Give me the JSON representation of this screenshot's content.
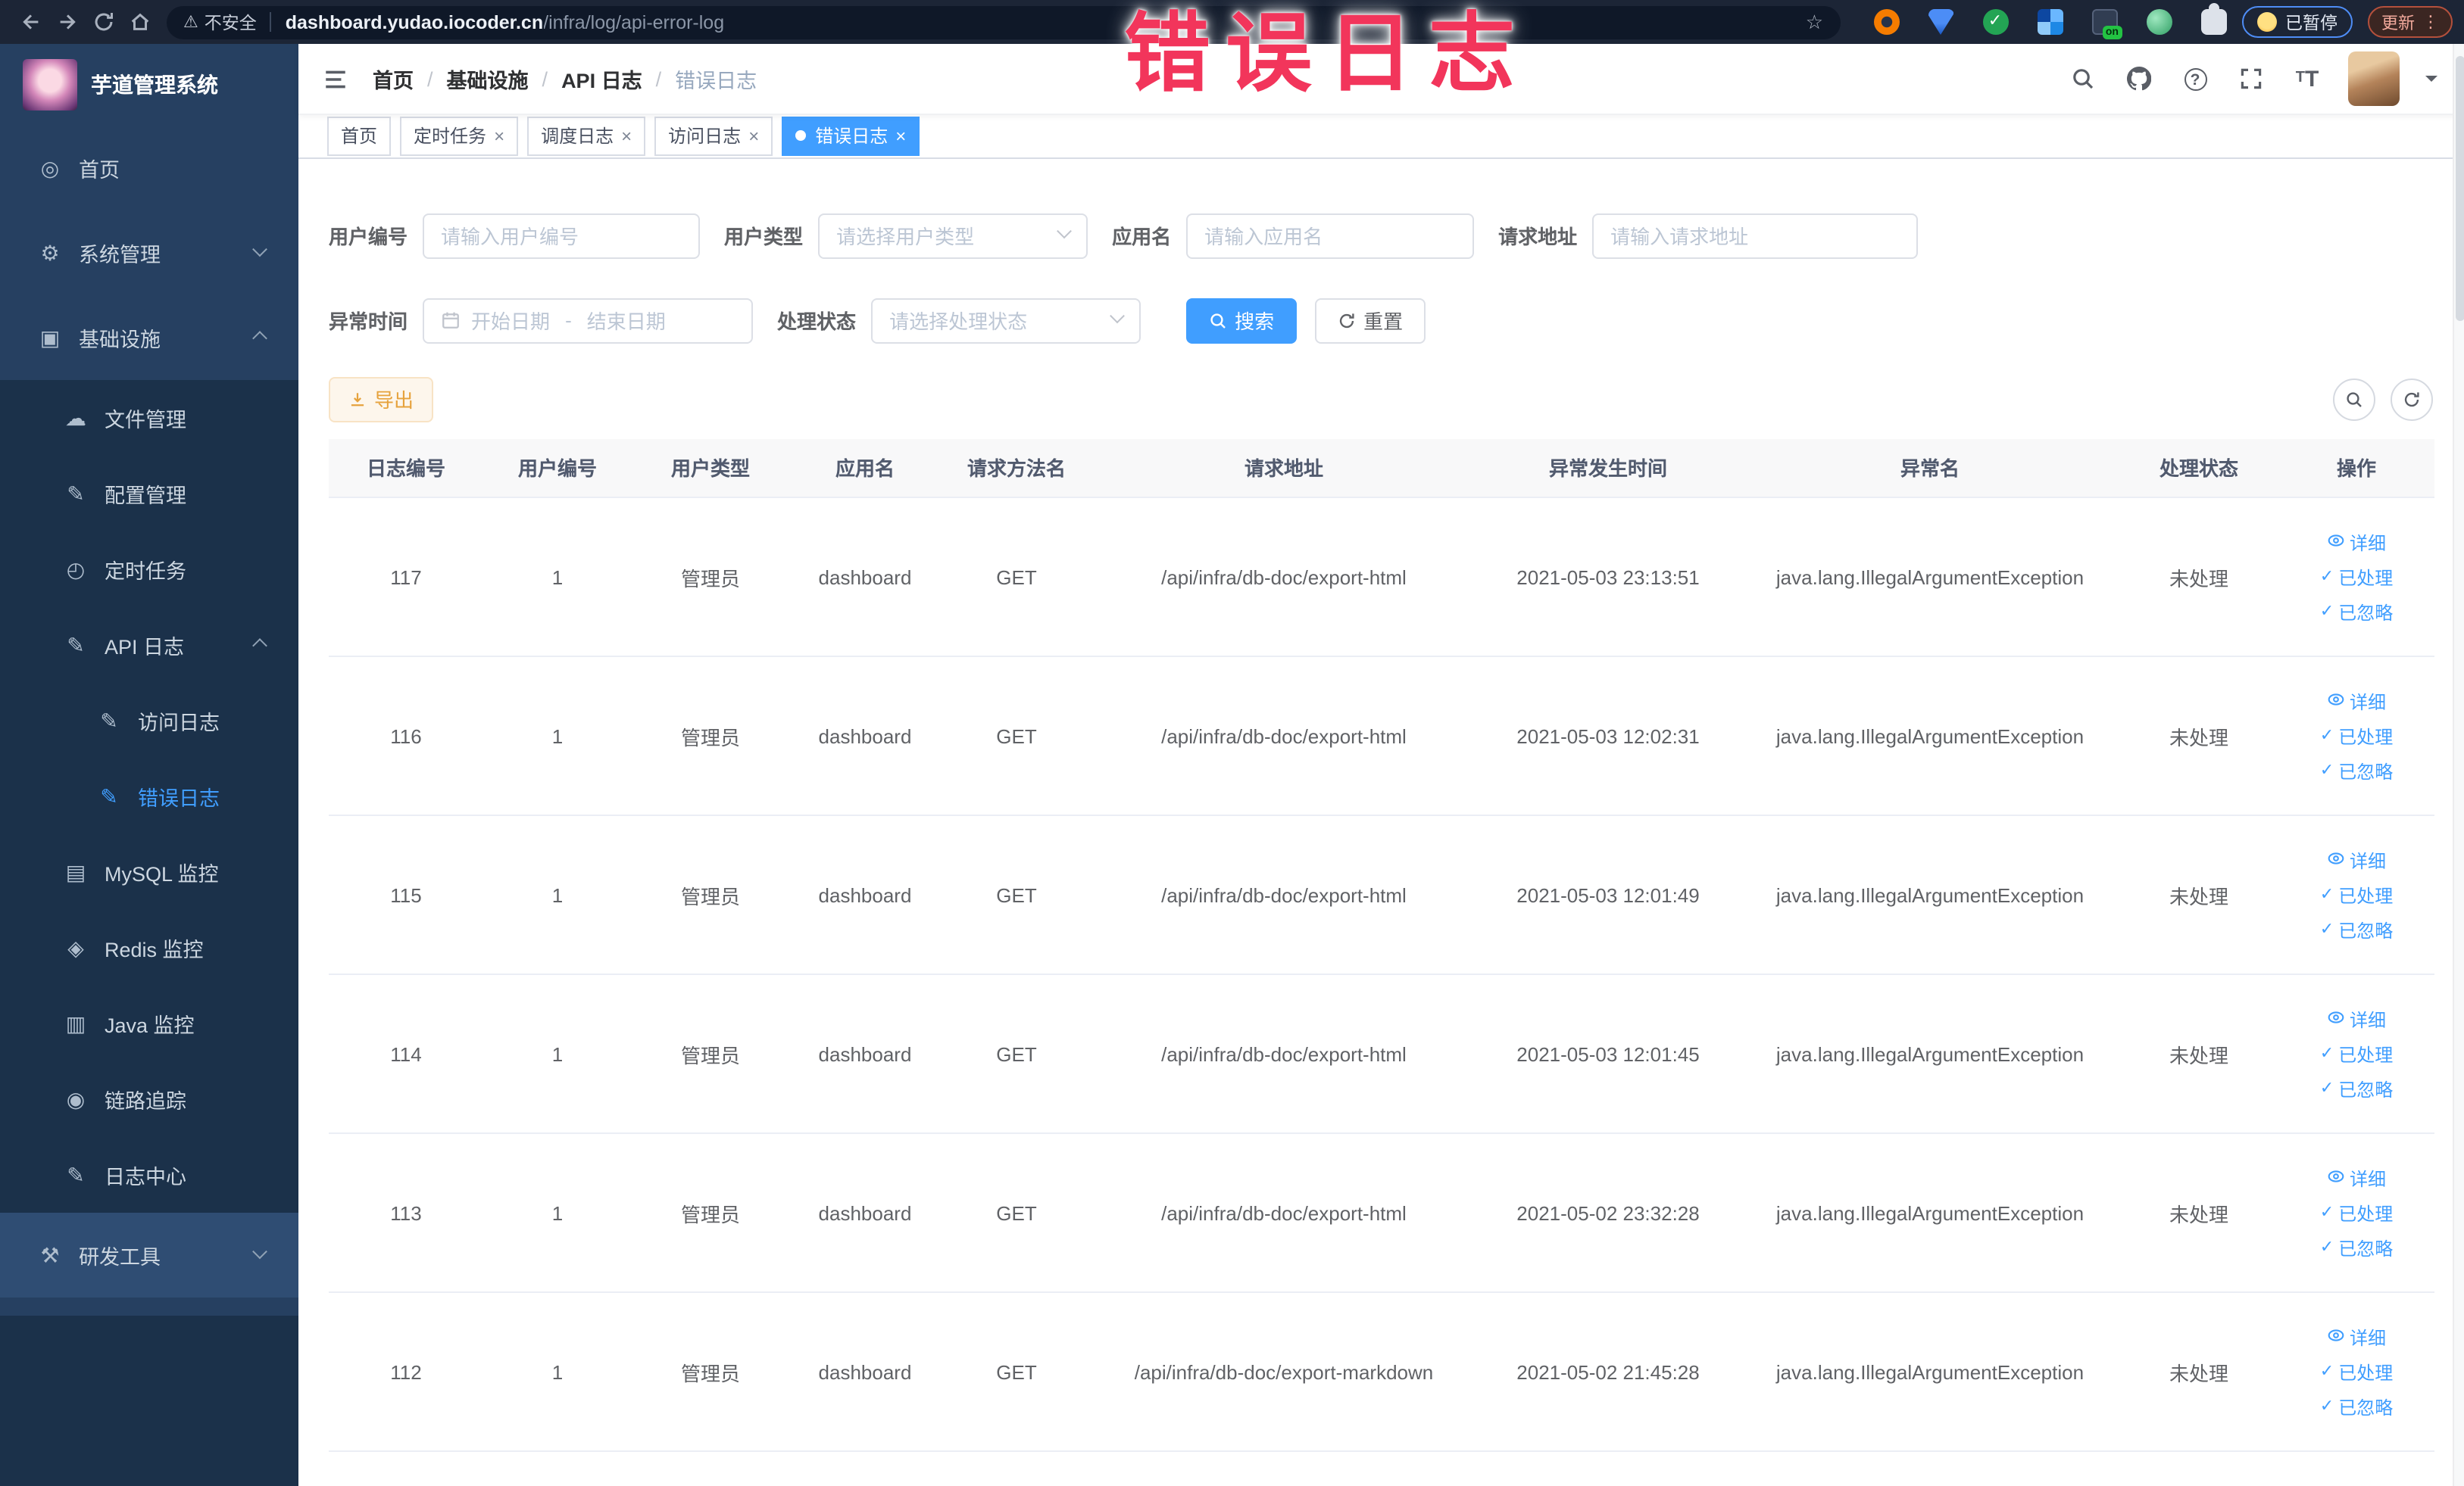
{
  "browser": {
    "security_label": "不安全",
    "url_host": "dashboard.yudao.iocoder.cn",
    "url_path": "/infra/log/api-error-log",
    "extensions": [
      "orange-circle",
      "blue-shield",
      "green-check-circle",
      "blue-grid",
      "dark-on-badge",
      "green-circle",
      "puzzle"
    ],
    "paused_badge": "已暂停",
    "update_button": "更新"
  },
  "annotation": {
    "text": "错误日志",
    "color": "#f2355b"
  },
  "sidebar": {
    "title": "芋道管理系统",
    "icon_glyphs": {
      "dashboard": "◎",
      "gear": "⚙",
      "infra": "▣",
      "cloud": "☁",
      "edit": "✎",
      "timer": "◴",
      "mysql": "▤",
      "redis": "◈",
      "java": "▥",
      "eye": "◉",
      "tools": "⚒"
    },
    "items": [
      {
        "label": "首页",
        "slug": "home",
        "icon": "dashboard",
        "level": 0
      },
      {
        "label": "系统管理",
        "slug": "system-management",
        "icon": "gear",
        "level": 0,
        "chevron": "down"
      },
      {
        "label": "基础设施",
        "slug": "infrastructure",
        "icon": "infra",
        "level": 0,
        "chevron": "up"
      },
      {
        "label": "文件管理",
        "slug": "file-management",
        "icon": "cloud",
        "level": 1
      },
      {
        "label": "配置管理",
        "slug": "config-management",
        "icon": "edit",
        "level": 1
      },
      {
        "label": "定时任务",
        "slug": "scheduled-tasks",
        "icon": "timer",
        "level": 1
      },
      {
        "label": "API 日志",
        "slug": "api-log",
        "icon": "edit",
        "level": 1,
        "chevron": "up"
      },
      {
        "label": "访问日志",
        "slug": "access-log",
        "icon": "edit",
        "level": 2
      },
      {
        "label": "错误日志",
        "slug": "error-log",
        "icon": "edit",
        "level": 2,
        "active": true
      },
      {
        "label": "MySQL 监控",
        "slug": "mysql-monitor",
        "icon": "mysql",
        "level": 1
      },
      {
        "label": "Redis 监控",
        "slug": "redis-monitor",
        "icon": "redis",
        "level": 1
      },
      {
        "label": "Java 监控",
        "slug": "java-monitor",
        "icon": "java",
        "level": 1
      },
      {
        "label": "链路追踪",
        "slug": "trace",
        "icon": "eye",
        "level": 1
      },
      {
        "label": "日志中心",
        "slug": "log-center",
        "icon": "edit",
        "level": 1
      },
      {
        "label": "研发工具",
        "slug": "dev-tools",
        "icon": "tools",
        "level": 0,
        "chevron": "down",
        "hover": true
      }
    ]
  },
  "navbar": {
    "breadcrumb": [
      {
        "label": "首页",
        "slug": "home"
      },
      {
        "label": "基础设施",
        "slug": "infrastructure"
      },
      {
        "label": "API 日志",
        "slug": "api-log"
      },
      {
        "label": "错误日志",
        "slug": "error-log"
      }
    ],
    "right_icons": [
      "search-icon",
      "github-icon",
      "help-icon",
      "fullscreen-icon",
      "font-size-icon",
      "avatar",
      "caret-down-icon"
    ]
  },
  "tags_view": {
    "tabs": [
      {
        "label": "首页",
        "slug": "home",
        "closable": false,
        "active": false
      },
      {
        "label": "定时任务",
        "slug": "scheduled-tasks",
        "closable": true,
        "active": false
      },
      {
        "label": "调度日志",
        "slug": "schedule-log",
        "closable": true,
        "active": false
      },
      {
        "label": "访问日志",
        "slug": "access-log",
        "closable": true,
        "active": false
      },
      {
        "label": "错误日志",
        "slug": "error-log",
        "closable": true,
        "active": true
      }
    ]
  },
  "filters": {
    "fields": [
      {
        "key": "user_id",
        "row": 1,
        "type": "input",
        "label": "用户编号",
        "placeholder": "请输入用户编号"
      },
      {
        "key": "user_type",
        "row": 1,
        "type": "select",
        "label": "用户类型",
        "placeholder": "请选择用户类型"
      },
      {
        "key": "app_name",
        "row": 1,
        "type": "input",
        "label": "应用名",
        "placeholder": "请输入应用名"
      },
      {
        "key": "request_url",
        "row": 1,
        "type": "input",
        "label": "请求地址",
        "placeholder": "请输入请求地址"
      },
      {
        "key": "error_time",
        "row": 2,
        "type": "daterange",
        "label": "异常时间",
        "start_placeholder": "开始日期",
        "separator": "-",
        "end_placeholder": "结束日期"
      },
      {
        "key": "process_status",
        "row": 2,
        "type": "select",
        "label": "处理状态",
        "placeholder": "请选择处理状态"
      }
    ],
    "search_label": "搜索",
    "reset_label": "重置"
  },
  "toolbar": {
    "export_label": "导出"
  },
  "table": {
    "columns": [
      "日志编号",
      "用户编号",
      "用户类型",
      "应用名",
      "请求方法名",
      "请求地址",
      "异常发生时间",
      "异常名",
      "处理状态",
      "操作"
    ],
    "column_keys": [
      "log_id",
      "user_id",
      "user_type",
      "app_name",
      "method",
      "url",
      "time",
      "exception",
      "status"
    ],
    "rows": [
      {
        "log_id": "117",
        "user_id": "1",
        "user_type": "管理员",
        "app_name": "dashboard",
        "method": "GET",
        "url": "/api/infra/db-doc/export-html",
        "time": "2021-05-03 23:13:51",
        "exception": "java.lang.IllegalArgumentException",
        "status": "未处理"
      },
      {
        "log_id": "116",
        "user_id": "1",
        "user_type": "管理员",
        "app_name": "dashboard",
        "method": "GET",
        "url": "/api/infra/db-doc/export-html",
        "time": "2021-05-03 12:02:31",
        "exception": "java.lang.IllegalArgumentException",
        "status": "未处理"
      },
      {
        "log_id": "115",
        "user_id": "1",
        "user_type": "管理员",
        "app_name": "dashboard",
        "method": "GET",
        "url": "/api/infra/db-doc/export-html",
        "time": "2021-05-03 12:01:49",
        "exception": "java.lang.IllegalArgumentException",
        "status": "未处理"
      },
      {
        "log_id": "114",
        "user_id": "1",
        "user_type": "管理员",
        "app_name": "dashboard",
        "method": "GET",
        "url": "/api/infra/db-doc/export-html",
        "time": "2021-05-03 12:01:45",
        "exception": "java.lang.IllegalArgumentException",
        "status": "未处理"
      },
      {
        "log_id": "113",
        "user_id": "1",
        "user_type": "管理员",
        "app_name": "dashboard",
        "method": "GET",
        "url": "/api/infra/db-doc/export-html",
        "time": "2021-05-02 23:32:28",
        "exception": "java.lang.IllegalArgumentException",
        "status": "未处理"
      },
      {
        "log_id": "112",
        "user_id": "1",
        "user_type": "管理员",
        "app_name": "dashboard",
        "method": "GET",
        "url": "/api/infra/db-doc/export-markdown",
        "time": "2021-05-02 21:45:28",
        "exception": "java.lang.IllegalArgumentException",
        "status": "未处理"
      }
    ],
    "row_actions": [
      {
        "label": "详细",
        "slug": "detail",
        "icon": "view"
      },
      {
        "label": "已处理",
        "slug": "processed",
        "icon": "check"
      },
      {
        "label": "已忽略",
        "slug": "ignored",
        "icon": "check"
      }
    ]
  },
  "colors": {
    "accent": "#409eff",
    "sidebar_bg": "#264061",
    "submenu_bg": "#1b314a",
    "export_bg": "#fdf6ec",
    "export_text": "#e6a23c",
    "annotation": "#f2355b"
  }
}
